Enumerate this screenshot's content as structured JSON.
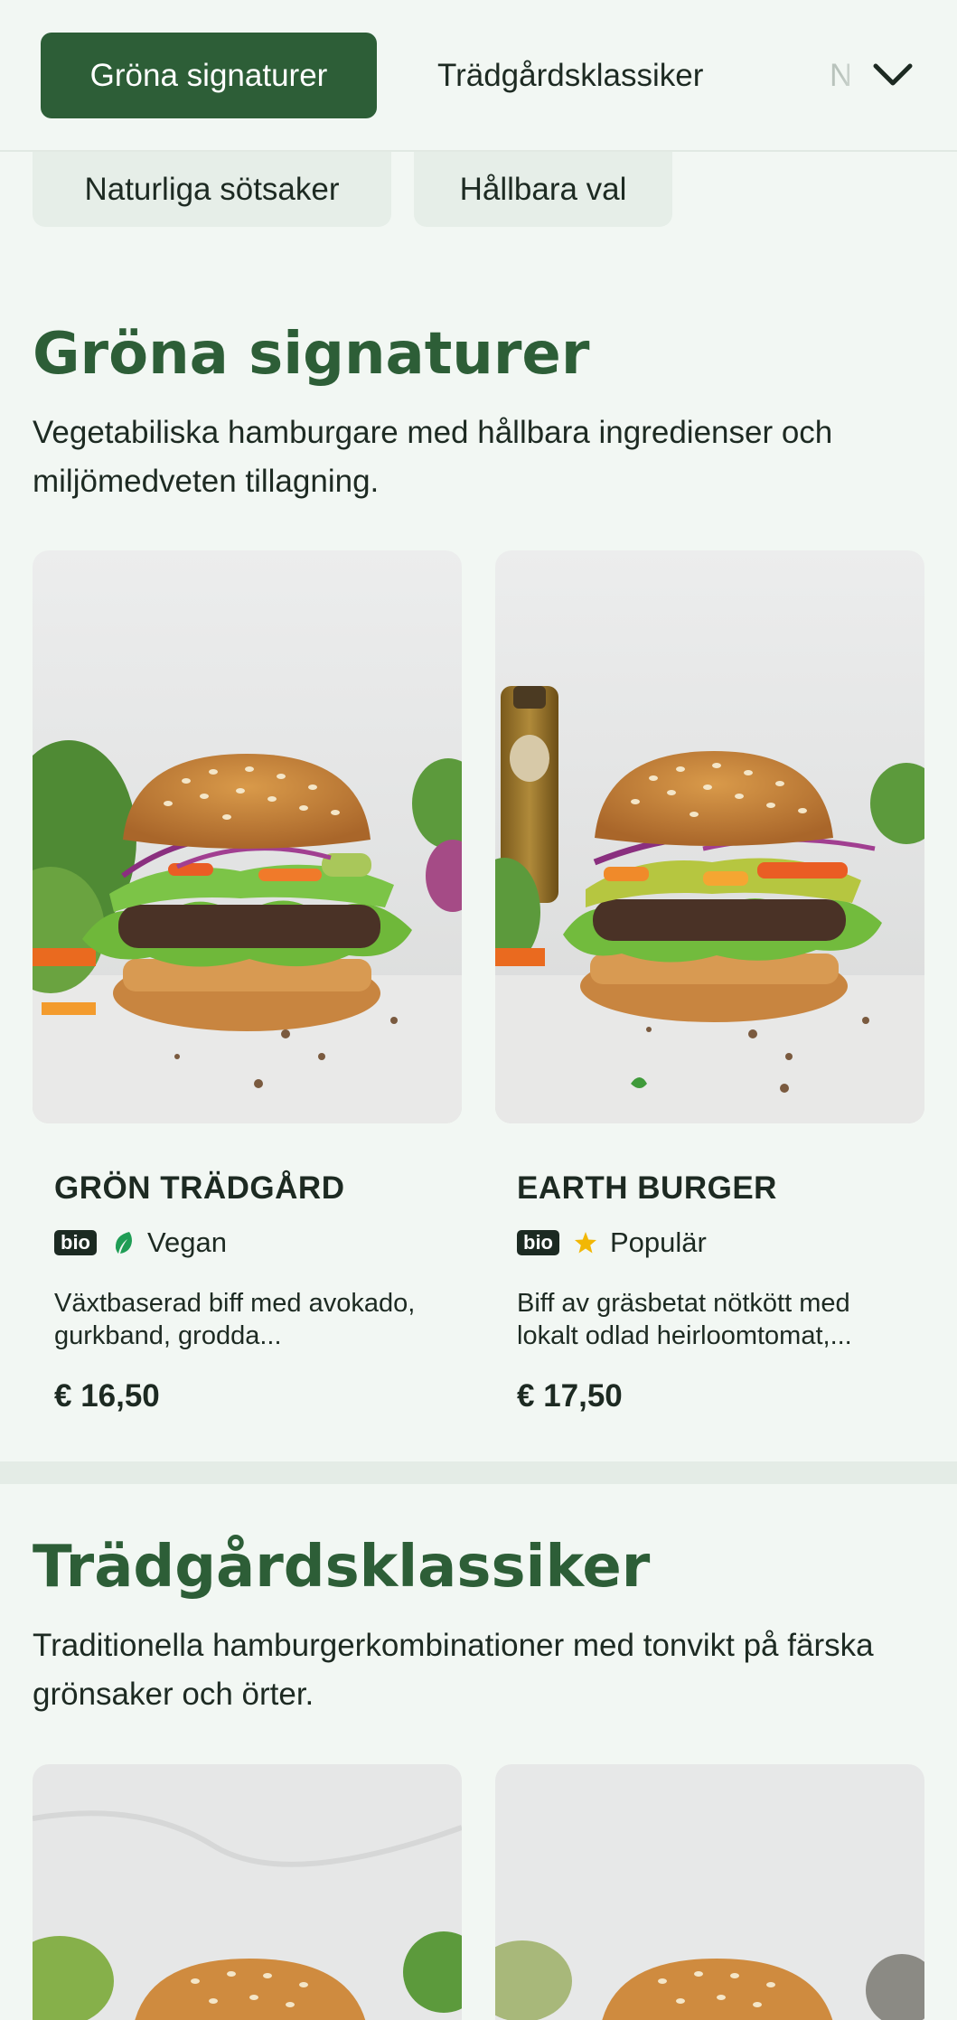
{
  "category_nav": {
    "tabs": [
      {
        "label": "Gröna signaturer",
        "active": true
      },
      {
        "label": "Trädgårdsklassiker",
        "active": false
      },
      {
        "label": "N",
        "active": false
      }
    ],
    "expand_icon": "chevron-down-icon",
    "row2": [
      "Naturliga sötsaker",
      "Hållbara val"
    ]
  },
  "sections": [
    {
      "title": "Gröna signaturer",
      "description": "Vegetabiliska hamburgare med hållbara ingredienser och miljömedveten tillagning.",
      "items": [
        {
          "name": "GRÖN TRÄDGÅRD",
          "badge": "bio",
          "tag_icon": "leaf-icon",
          "tag": "Vegan",
          "description": "Växtbaserad biff med avokado, gurkband, grodda...",
          "price": "€ 16,50"
        },
        {
          "name": "EARTH BURGER",
          "badge": "bio",
          "tag_icon": "star-icon",
          "tag": "Populär",
          "description": "Biff av gräsbetat nötkött med lokalt odlad heirloomtomat,...",
          "price": "€ 17,50"
        }
      ]
    },
    {
      "title": "Trädgårdsklassiker",
      "description": "Traditionella hamburgerkombinationer med tonvikt på färska grönsaker och örter."
    }
  ],
  "colors": {
    "brand_green": "#2d5e37",
    "background": "#f2f7f3",
    "vegan_leaf": "#1f9d55",
    "popular_star": "#f2b705"
  }
}
